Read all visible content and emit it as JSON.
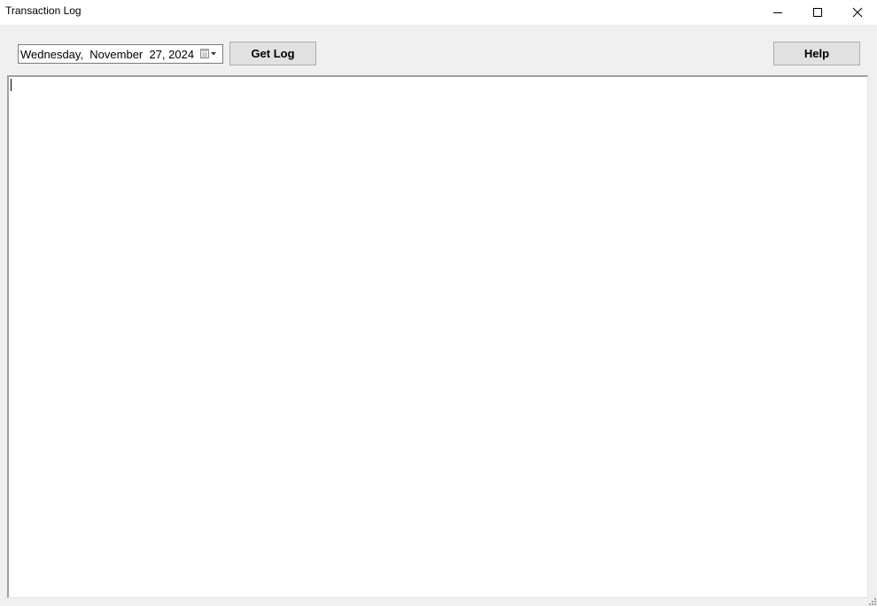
{
  "window": {
    "title": "Transaction Log",
    "controls": {
      "minimize": "minimize-icon",
      "maximize": "maximize-icon",
      "close": "close-icon"
    }
  },
  "toolbar": {
    "date_value": "Wednesday,  November  27, 2024",
    "date_dropdown_icon": "calendar-dropdown-icon",
    "get_log_label": "Get Log",
    "help_label": "Help"
  },
  "log": {
    "content": ""
  },
  "colors": {
    "window_bg": "#f0f0f0",
    "titlebar_bg": "#ffffff",
    "button_bg": "#e1e1e1",
    "button_border": "#adadad",
    "field_border": "#7a7a7a"
  }
}
